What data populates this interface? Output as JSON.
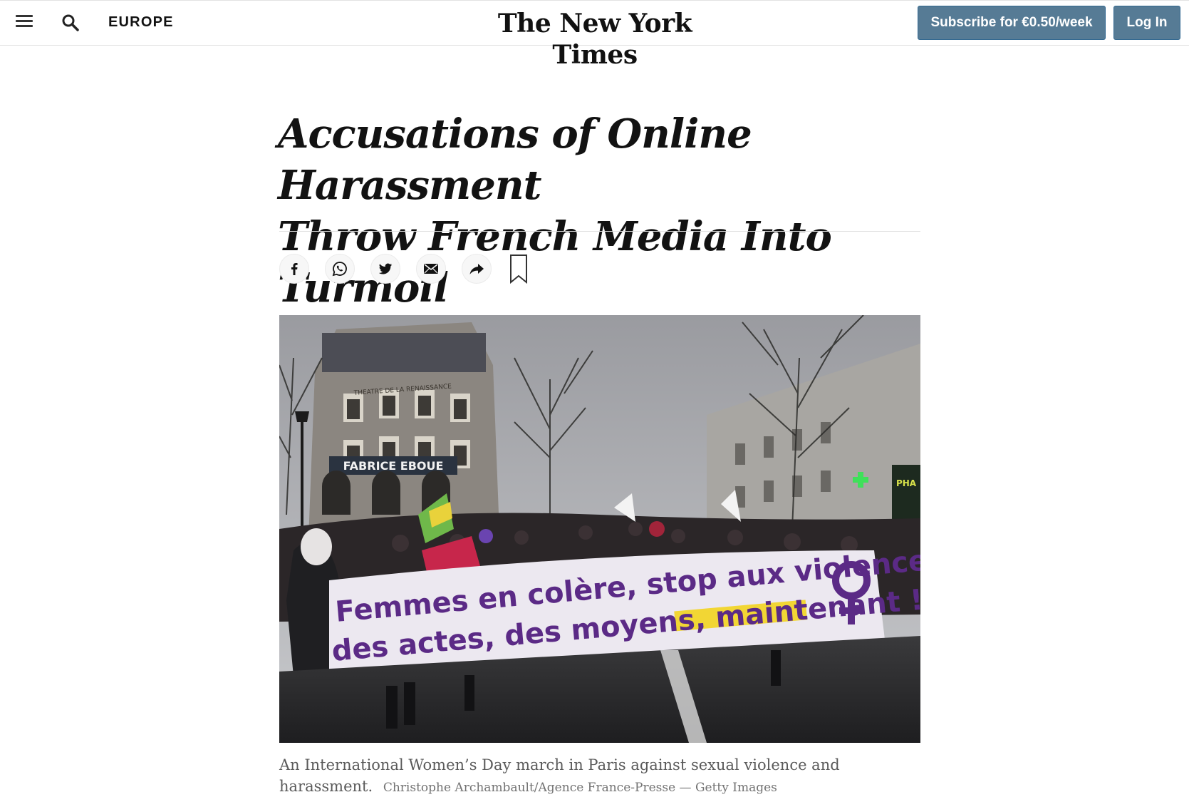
{
  "header": {
    "section": "EUROPE",
    "logo": "The New York Times",
    "subscribe_label": "Subscribe for €0.50/week",
    "login_label": "Log In"
  },
  "article": {
    "headline_line1": "Accusations of Online Harassment",
    "headline_line2": "Throw French Media Into Turmoil",
    "caption": "An International Women’s Day march in Paris against sexual violence and harassment.",
    "credit": "Christophe Archambault/Agence France-Presse — Getty Images"
  },
  "share": {
    "icons": [
      "facebook-icon",
      "whatsapp-icon",
      "twitter-icon",
      "email-icon",
      "share-icon",
      "bookmark-icon"
    ]
  },
  "photo": {
    "sign_text": "FABRICE EBOUE",
    "building_text": "THEATRE DE LA RENAISSANCE",
    "banner_line1": "Femmes en colère, stop aux violences,",
    "banner_line2": "des actes, des moyens, maintenant !",
    "pharmacy_text": "PHA"
  },
  "colors": {
    "button_bg": "#567b95",
    "banner_text": "#5b2a86",
    "banner_highlight": "#f2d634"
  }
}
